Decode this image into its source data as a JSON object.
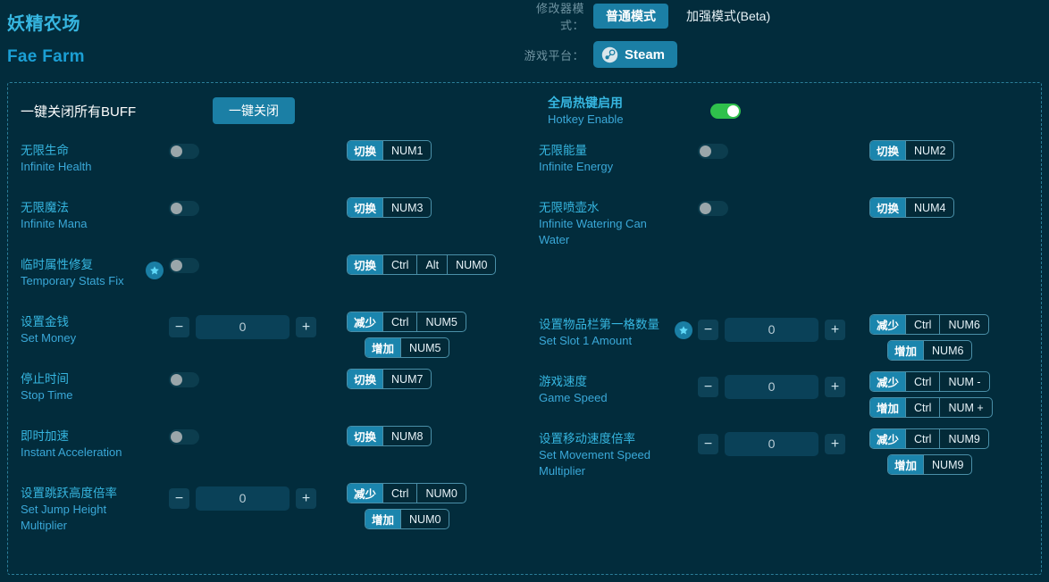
{
  "brand": {
    "cn": "妖精农场",
    "en": "Fae Farm"
  },
  "header": {
    "mode_label": "修改器模式：",
    "mode_tabs": [
      {
        "label": "普通模式",
        "active": true
      },
      {
        "label": "加强模式(Beta)",
        "active": false
      }
    ],
    "platform_label": "游戏平台：",
    "platform": {
      "name": "Steam",
      "icon": "steam-icon"
    }
  },
  "topbar": {
    "buff_label": "一键关闭所有BUFF",
    "buff_button": "一键关闭",
    "hotkey": {
      "cn": "全局热键启用",
      "en": "Hotkey Enable",
      "on": true
    }
  },
  "rows_left": [
    {
      "cn": "无限生命",
      "en": "Infinite Health",
      "star": false,
      "control": "toggle",
      "toggle_on": false,
      "keys": [
        {
          "action": "切换",
          "keys": [
            "NUM1"
          ]
        }
      ]
    },
    {
      "cn": "无限魔法",
      "en": "Infinite Mana",
      "star": false,
      "control": "toggle",
      "toggle_on": false,
      "keys": [
        {
          "action": "切换",
          "keys": [
            "NUM3"
          ]
        }
      ]
    },
    {
      "cn": "临时属性修复",
      "en": "Temporary Stats Fix",
      "star": true,
      "control": "toggle",
      "toggle_on": false,
      "keys": [
        {
          "action": "切换",
          "keys": [
            "Ctrl",
            "Alt",
            "NUM0"
          ]
        }
      ]
    },
    {
      "cn": "设置金钱",
      "en": "Set Money",
      "star": false,
      "control": "stepper",
      "value": "0",
      "keys": [
        {
          "action": "减少",
          "keys": [
            "Ctrl",
            "NUM5"
          ]
        },
        {
          "action": "增加",
          "keys": [
            "NUM5"
          ],
          "indent": true
        }
      ]
    },
    {
      "cn": "停止时间",
      "en": "Stop Time",
      "star": false,
      "control": "toggle",
      "toggle_on": false,
      "keys": [
        {
          "action": "切换",
          "keys": [
            "NUM7"
          ]
        }
      ]
    },
    {
      "cn": "即时加速",
      "en": "Instant Acceleration",
      "star": false,
      "control": "toggle",
      "toggle_on": false,
      "keys": [
        {
          "action": "切换",
          "keys": [
            "NUM8"
          ]
        }
      ]
    },
    {
      "cn": "设置跳跃高度倍率",
      "en": "Set Jump Height Multiplier",
      "star": false,
      "control": "stepper",
      "value": "0",
      "keys": [
        {
          "action": "减少",
          "keys": [
            "Ctrl",
            "NUM0"
          ]
        },
        {
          "action": "增加",
          "keys": [
            "NUM0"
          ],
          "indent": true
        }
      ]
    }
  ],
  "rows_right": [
    {
      "cn": "无限能量",
      "en": "Infinite Energy",
      "star": false,
      "control": "toggle",
      "toggle_on": false,
      "keys": [
        {
          "action": "切换",
          "keys": [
            "NUM2"
          ]
        }
      ]
    },
    {
      "cn": "无限喷壶水",
      "en": "Infinite Watering Can Water",
      "star": false,
      "control": "toggle",
      "toggle_on": false,
      "keys": [
        {
          "action": "切换",
          "keys": [
            "NUM4"
          ]
        }
      ]
    },
    {
      "cn": "",
      "en": "",
      "star": false,
      "control": "none",
      "keys": []
    },
    {
      "cn": "设置物品栏第一格数量",
      "en": "Set Slot 1 Amount",
      "star": true,
      "control": "stepper",
      "value": "0",
      "keys": [
        {
          "action": "减少",
          "keys": [
            "Ctrl",
            "NUM6"
          ]
        },
        {
          "action": "增加",
          "keys": [
            "NUM6"
          ],
          "indent": true
        }
      ]
    },
    {
      "cn": "游戏速度",
      "en": "Game Speed",
      "star": false,
      "control": "stepper",
      "value": "0",
      "keys": [
        {
          "action": "减少",
          "keys": [
            "Ctrl",
            "NUM -"
          ]
        },
        {
          "action": "增加",
          "keys": [
            "Ctrl",
            "NUM +"
          ]
        }
      ]
    },
    {
      "cn": "设置移动速度倍率",
      "en": "Set Movement Speed Multiplier",
      "star": false,
      "control": "stepper",
      "value": "0",
      "keys": [
        {
          "action": "减少",
          "keys": [
            "Ctrl",
            "NUM9"
          ]
        },
        {
          "action": "增加",
          "keys": [
            "NUM9"
          ],
          "indent": true
        }
      ]
    }
  ],
  "icons": {
    "minus": "−",
    "plus": "+"
  },
  "colors": {
    "background": "#022c3c",
    "accent": "#1b7fa5",
    "title": "#36b6e0",
    "label": "#3aa8d8",
    "toggle_on": "#2fc14c"
  }
}
